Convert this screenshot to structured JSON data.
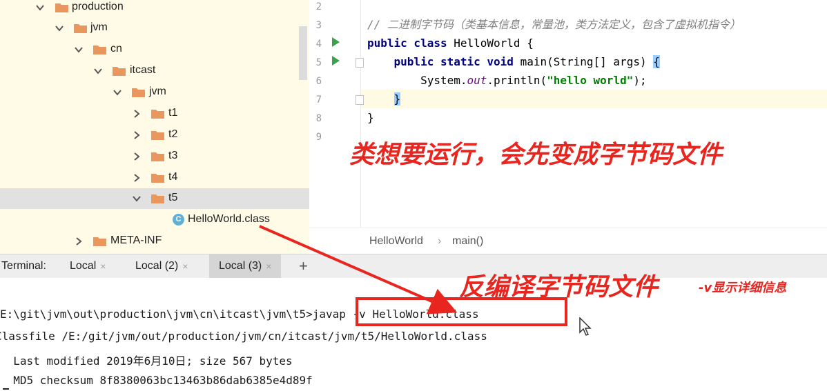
{
  "tree": {
    "items": [
      {
        "label": "production",
        "type": "folder",
        "expanded": true
      },
      {
        "label": "jvm",
        "type": "folder",
        "expanded": true
      },
      {
        "label": "cn",
        "type": "folder",
        "expanded": true
      },
      {
        "label": "itcast",
        "type": "folder",
        "expanded": true
      },
      {
        "label": "jvm",
        "type": "folder",
        "expanded": true
      },
      {
        "label": "t1",
        "type": "folder",
        "expanded": false
      },
      {
        "label": "t2",
        "type": "folder",
        "expanded": false
      },
      {
        "label": "t3",
        "type": "folder",
        "expanded": false
      },
      {
        "label": "t4",
        "type": "folder",
        "expanded": false
      },
      {
        "label": "t5",
        "type": "folder",
        "expanded": true,
        "selected": true
      },
      {
        "label": "HelloWorld.class",
        "type": "class"
      },
      {
        "label": "META-INF",
        "type": "folder",
        "expanded": false
      }
    ]
  },
  "editor": {
    "line_numbers": [
      "2",
      "3",
      "4",
      "5",
      "6",
      "7",
      "8",
      "9"
    ],
    "code": {
      "l3_comment": "// 二进制字节码（类基本信息，常量池，类方法定义，包含了虚拟机指令）",
      "l4_kw": "public class ",
      "l4_rest": "HelloWorld {",
      "l5_indent": "    ",
      "l5_kw": "public static void ",
      "l5_rest": "main(String[] args) ",
      "l5_brace": "{",
      "l6_a": "        System.",
      "l6_field": "out",
      "l6_b": ".println(",
      "l6_str": "\"hello world\"",
      "l6_c": ");",
      "l7_indent": "    ",
      "l7_brace": "}",
      "l8": "}"
    },
    "breadcrumb": [
      "HelloWorld",
      "main()"
    ],
    "breadcrumb_sep": "›"
  },
  "annotations": {
    "compile_note": "类想要运行，会先变成字节码文件",
    "decompile_note": "反编译字节码文件",
    "verbose_note": "-v显示详细信息",
    "color": "#e8251f"
  },
  "terminal": {
    "tabs_title": "Terminal:",
    "tabs": [
      {
        "label": "Local",
        "active": false
      },
      {
        "label": "Local (2)",
        "active": false
      },
      {
        "label": "Local (3)",
        "active": true
      }
    ],
    "add_label": "+",
    "close_glyph": "×",
    "lines": {
      "prompt": "E:\\git\\jvm\\out\\production\\jvm\\cn\\itcast\\jvm\\t5",
      "prompt_sep": ">",
      "command": "javap -v HelloWorld.class",
      "classfile": "Classfile /E:/git/jvm/out/production/jvm/cn/itcast/jvm/t5/HelloWorld.class",
      "modified": "  Last modified 2019年6月10日; size 567 bytes",
      "md5": "  MD5 checksum 8f8380063bc13463b86dab6385e4d89f"
    }
  }
}
